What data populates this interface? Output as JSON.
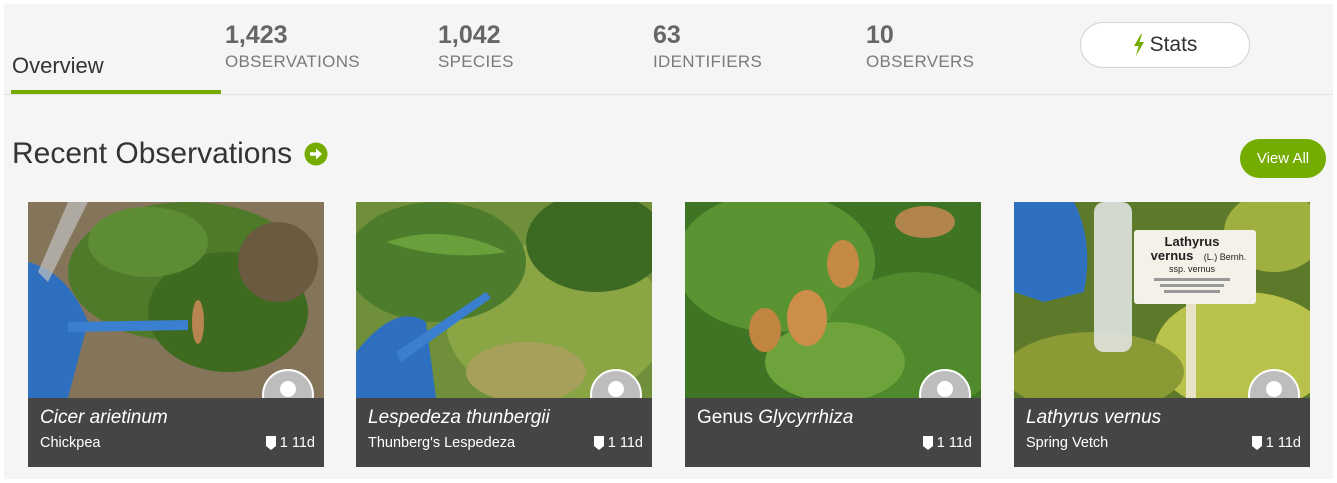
{
  "tabs": {
    "overview_label": "Overview"
  },
  "stats": [
    {
      "number": "1,423",
      "label": "OBSERVATIONS"
    },
    {
      "number": "1,042",
      "label": "SPECIES"
    },
    {
      "number": "63",
      "label": "IDENTIFIERS"
    },
    {
      "number": "10",
      "label": "OBSERVERS"
    }
  ],
  "stats_button": {
    "label": "Stats",
    "icon": "lightning-icon",
    "icon_color": "#74ac00"
  },
  "recent": {
    "title": "Recent Observations",
    "view_all_label": "View All",
    "accent_color": "#74ac00"
  },
  "observations": [
    {
      "sci_prefix": "",
      "sci_name": "Cicer arietinum",
      "common": "Chickpea",
      "ids": "1",
      "age": "11d"
    },
    {
      "sci_prefix": "",
      "sci_name": "Lespedeza thunbergii",
      "common": "Thunberg's Lespedeza",
      "ids": "1",
      "age": "11d"
    },
    {
      "sci_prefix": "Genus ",
      "sci_name": "Glycyrrhiza",
      "common": "",
      "ids": "1",
      "age": "11d"
    },
    {
      "sci_prefix": "",
      "sci_name": "Lathyrus vernus",
      "common": "Spring Vetch",
      "ids": "1",
      "age": "11d"
    }
  ],
  "label_sign": {
    "line1": "Lathyrus",
    "line2": "vernus",
    "author": "(L.) Bernh.",
    "line3": "ssp. vernus"
  }
}
